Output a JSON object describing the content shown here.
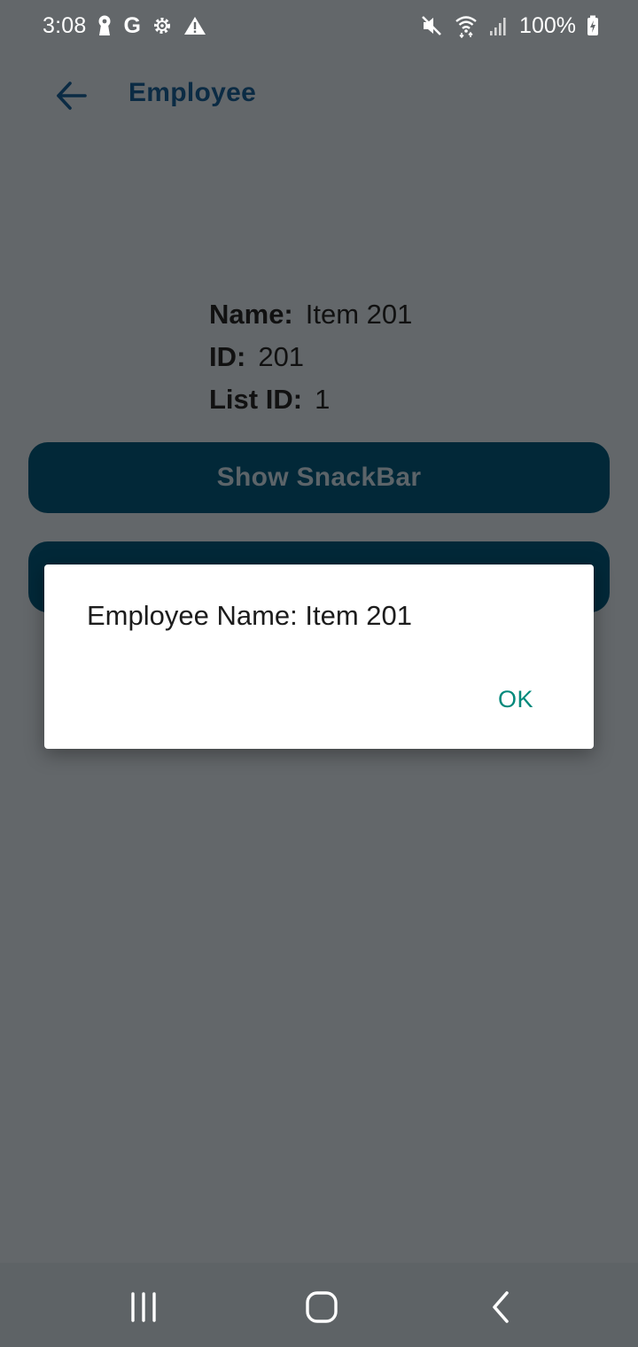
{
  "status_bar": {
    "time": "3:08",
    "left_icons": [
      "keyhole-icon",
      "google-icon",
      "settings-icon",
      "warning-icon"
    ],
    "google_glyph": "G",
    "right_icons": [
      "mute-icon",
      "wifi-icon",
      "signal-icon",
      "battery-charging-icon"
    ],
    "battery": "100%"
  },
  "app_bar": {
    "title": "Employee",
    "back_icon": "arrow-left-icon",
    "accent_color": "#0b2b44"
  },
  "details": {
    "name_label": "Name:",
    "name_value": "Item 201",
    "id_label": "ID:",
    "id_value": "201",
    "list_id_label": "List ID:",
    "list_id_value": "1"
  },
  "buttons": {
    "show_snackbar": "Show SnackBar",
    "button_color": "#022838"
  },
  "dialog": {
    "message": "Employee Name: Item 201",
    "ok_label": "OK",
    "ok_color": "#00897b"
  },
  "nav_bar": {
    "icons": [
      "recents-icon",
      "home-icon",
      "back-icon"
    ]
  }
}
